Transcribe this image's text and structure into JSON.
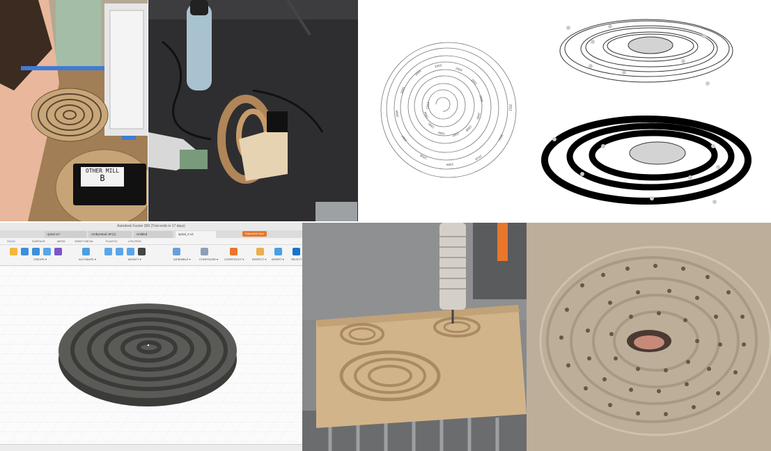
{
  "photos": {
    "workshop_sign_line1": "OTHER MILL",
    "workshop_sign_line2": "B"
  },
  "spiral_labels": {
    "sample": [
      "2012",
      "2011",
      "2010",
      "2009",
      "2008",
      "2007",
      "2006",
      "2005",
      "2004",
      "2003",
      "2002",
      "2001",
      "2000",
      "1999",
      "1998",
      "1997",
      "1996",
      "1995",
      "1994",
      "1993"
    ]
  },
  "fusion": {
    "window_title": "Autodesk Fusion 360 (Trial ends in 17 days)",
    "tabs": [
      {
        "label": "spiral v1*"
      },
      {
        "label": "AmbyHead v8*(1)"
      },
      {
        "label": "Untitled"
      },
      {
        "label": "spiral_2 v2"
      }
    ],
    "subscribe_label": "Subscribe Now",
    "ribbon_tabs": [
      "SOLID",
      "SURFACE",
      "MESH",
      "SHEET METAL",
      "PLASTIC",
      "UTILITIES"
    ],
    "groups": [
      "CREATE ▾",
      "AUTOMATE ▾",
      "MODIFY ▾",
      "ASSEMBLE ▾",
      "CONFIGURE ▾",
      "CONSTRUCT ▾",
      "INSPECT ▾",
      "INSERT ▾",
      "SELECT"
    ]
  },
  "colors": {
    "accent_orange": "#e8762c",
    "fusion_blue": "#1a73c9",
    "model_gray": "#4a4a47"
  }
}
